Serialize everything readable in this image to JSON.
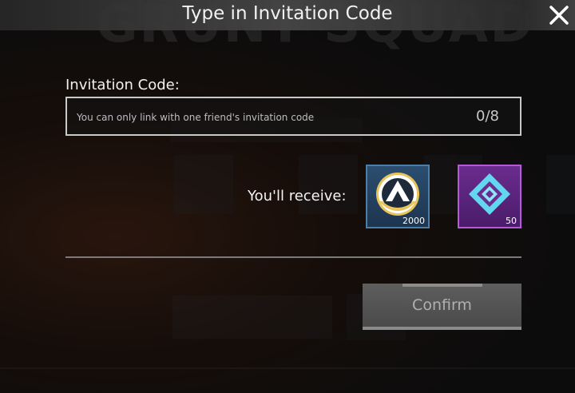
{
  "header": {
    "title": "Type in Invitation Code"
  },
  "form": {
    "label": "Invitation Code:",
    "placeholder": "You can only link with one friend's invitation code",
    "value": "",
    "char_count": "0/8"
  },
  "rewards": {
    "label": "You'll receive:",
    "items": [
      {
        "icon": "apex-coins-icon",
        "quantity": "2000",
        "color": "#2c4e70"
      },
      {
        "icon": "crafting-metals-icon",
        "quantity": "50",
        "color": "#6a2c8e"
      }
    ]
  },
  "actions": {
    "confirm_label": "Confirm"
  },
  "colors": {
    "accent_blue": "#4d7fa6",
    "accent_purple": "#b25ad8"
  }
}
